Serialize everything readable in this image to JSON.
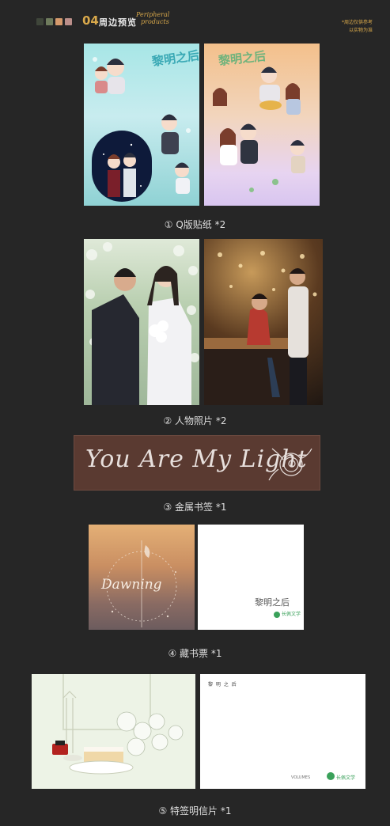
{
  "header": {
    "swatches": [
      "#3f463a",
      "#6f7c5d",
      "#d59a6c",
      "#bb8f8a"
    ],
    "number": "04",
    "title": "周边预览",
    "script_line1": "Peripheral",
    "script_line2": "products",
    "note_line1": "*周边仅供参考",
    "note_line2": "以实物为准"
  },
  "items": [
    {
      "caption": "① Q版贴纸 *2"
    },
    {
      "caption": "② 人物照片 *2"
    },
    {
      "caption": "③ 金属书签 *1"
    },
    {
      "caption": "④ 藏书票 *1"
    },
    {
      "caption": "⑤ 特签明信片 *1"
    }
  ],
  "stickers": {
    "left_logo": "黎明之后",
    "right_logo": "黎明之后"
  },
  "bookmark": {
    "text": "You Are My Light"
  },
  "bookplate": {
    "left_script": "Dawning",
    "right_logo": "黎明之后",
    "right_brand": "长佩文学"
  },
  "postcard": {
    "right_title": "黎 明 之 后",
    "right_brand": "长佩文学",
    "right_label": "VOLUMES"
  }
}
